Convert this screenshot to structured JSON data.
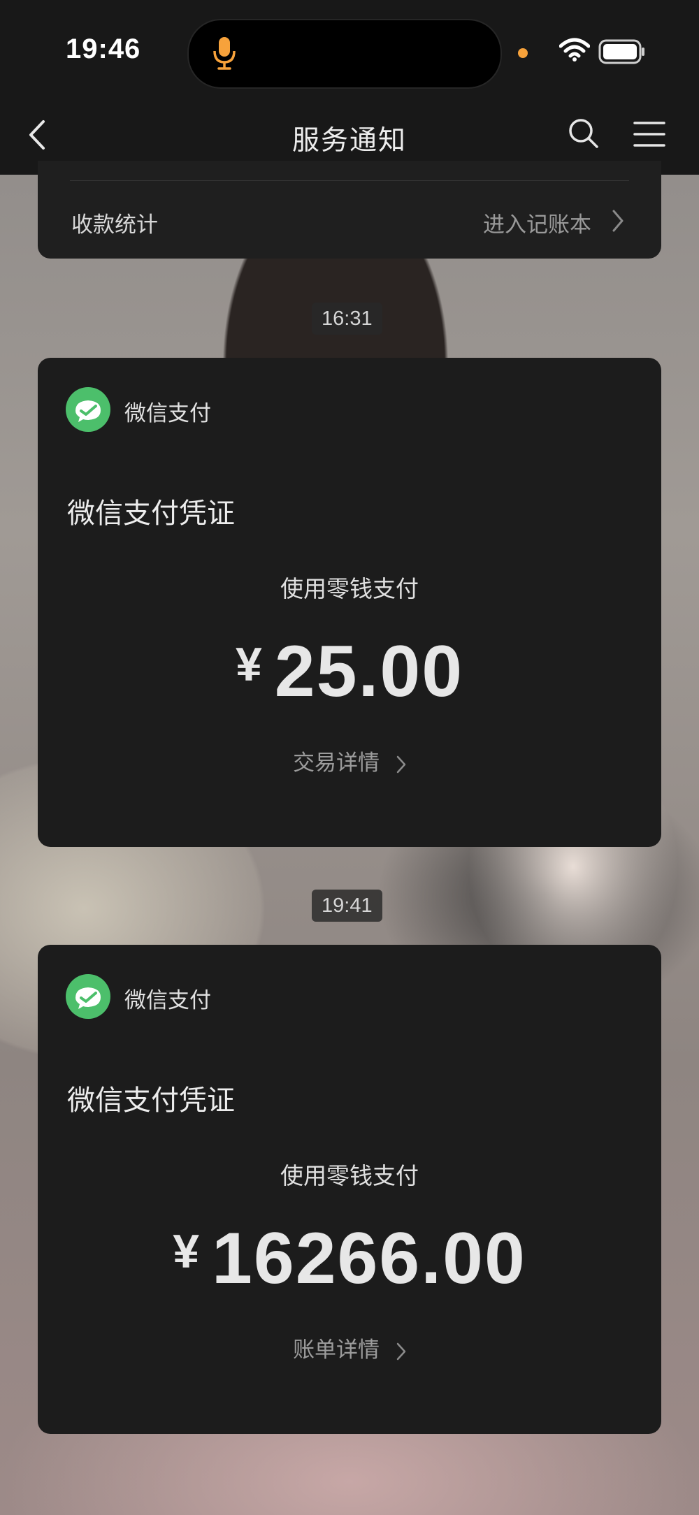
{
  "status_bar": {
    "time": "19:46"
  },
  "nav": {
    "title": "服务通知"
  },
  "top_card": {
    "left_label": "收款统计",
    "right_link": "进入记账本"
  },
  "messages": [
    {
      "timestamp": "16:31",
      "app_name": "微信支付",
      "title": "微信支付凭证",
      "method": "使用零钱支付",
      "currency": "¥",
      "amount": "25.00",
      "detail_link": "交易详情"
    },
    {
      "timestamp": "19:41",
      "app_name": "微信支付",
      "title": "微信支付凭证",
      "method": "使用零钱支付",
      "currency": "¥",
      "amount": "16266.00",
      "detail_link": "账单详情"
    }
  ],
  "icons": {
    "back": "chevron-left-icon",
    "search": "search-icon",
    "menu": "menu-icon",
    "wechat_pay": "wechat-pay-icon",
    "mic": "microphone-icon",
    "wifi": "wifi-icon",
    "battery": "battery-icon"
  },
  "colors": {
    "wechat_green": "#4cbf6b",
    "card_bg": "#1c1c1c",
    "topbar_bg": "#181818",
    "mic_orange": "#f7a23b"
  }
}
